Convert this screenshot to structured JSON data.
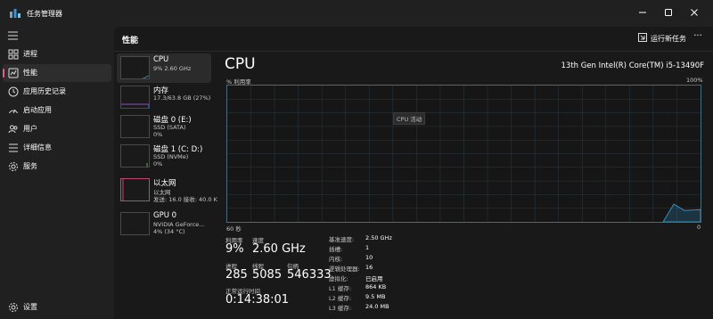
{
  "window": {
    "title": "任务管理器"
  },
  "nav": {
    "items": [
      {
        "label": "进程"
      },
      {
        "label": "性能"
      },
      {
        "label": "应用历史记录"
      },
      {
        "label": "启动应用"
      },
      {
        "label": "用户"
      },
      {
        "label": "详细信息"
      },
      {
        "label": "服务"
      }
    ],
    "settings_label": "设置"
  },
  "header": {
    "title": "性能",
    "run_task_label": "运行新任务",
    "more_label": "···"
  },
  "devices": [
    {
      "name": "CPU",
      "line1": "9% 2.60 GHz",
      "line2": ""
    },
    {
      "name": "内存",
      "line1": "17.3/63.8 GB (27%)",
      "line2": ""
    },
    {
      "name": "磁盘 0 (E:)",
      "line1": "SSD (SATA)",
      "line2": "0%"
    },
    {
      "name": "磁盘 1 (C: D:)",
      "line1": "SSD (NVMe)",
      "line2": "0%"
    },
    {
      "name": "以太网",
      "line1": "以太网",
      "line2": "发送: 16.0 接收: 40.0 K"
    },
    {
      "name": "GPU 0",
      "line1": "NVIDIA GeForce...",
      "line2": "4% (34 °C)"
    }
  ],
  "cpu": {
    "title": "CPU",
    "model": "13th Gen Intel(R) Core(TM) i5-13490F",
    "axis_top_left": "% 利用率",
    "axis_top_right": "100%",
    "axis_bottom_left": "60 秒",
    "axis_bottom_right": "0",
    "graph_tooltip": "CPU 活动",
    "utilization_pct": 9,
    "stats": {
      "utilization_label": "利用率",
      "utilization_value": "9%",
      "speed_label": "速度",
      "speed_value": "2.60 GHz",
      "processes_label": "进程",
      "processes_value": "285",
      "threads_label": "线程",
      "threads_value": "5085",
      "handles_label": "句柄",
      "handles_value": "546333",
      "uptime_label": "正常运行时间",
      "uptime_value": "0:14:38:01"
    },
    "info": [
      {
        "key": "基准速度:",
        "value": "2.50 GHz"
      },
      {
        "key": "插槽:",
        "value": "1"
      },
      {
        "key": "内核:",
        "value": "10"
      },
      {
        "key": "逻辑处理器:",
        "value": "16"
      },
      {
        "key": "虚拟化:",
        "value": "已启用"
      },
      {
        "key": "L1 缓存:",
        "value": "864 KB"
      },
      {
        "key": "L2 缓存:",
        "value": "9.5 MB"
      },
      {
        "key": "L3 缓存:",
        "value": "24.0 MB"
      }
    ]
  },
  "colors": {
    "accent": "#e0608c",
    "cpu_line": "#2f8fc4",
    "mem_line": "#8c4ec6",
    "disk_line": "#58b04a",
    "eth_line": "#d0427a"
  }
}
